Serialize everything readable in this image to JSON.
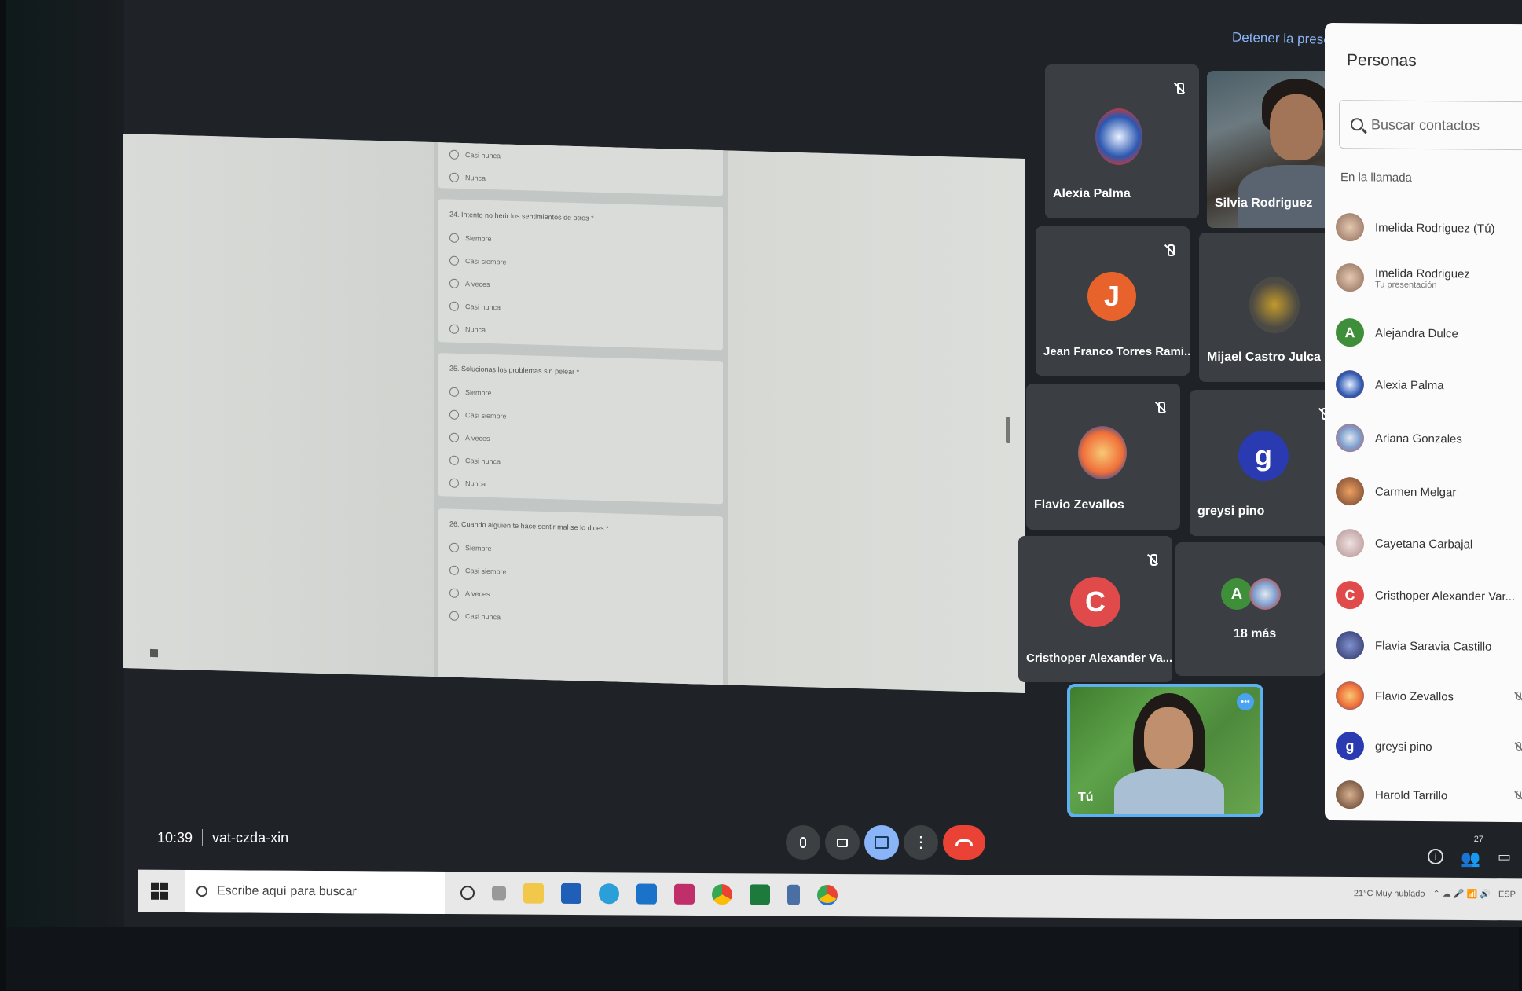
{
  "meet": {
    "stop_presenting": "Detener la presentación",
    "time": "10:39",
    "meeting_code": "vat-czda-xin"
  },
  "form": {
    "prev_options": [
      "Casi nunca",
      "Nunca"
    ],
    "questions": [
      {
        "title": "24. Intento no herir los sentimientos de otros *",
        "options": [
          "Siempre",
          "Casi siempre",
          "A veces",
          "Casi nunca",
          "Nunca"
        ]
      },
      {
        "title": "25. Solucionas los problemas sin pelear *",
        "options": [
          "Siempre",
          "Casi siempre",
          "A veces",
          "Casi nunca",
          "Nunca"
        ]
      },
      {
        "title": "26. Cuando alguien te hace sentir mal se lo dices *",
        "options": [
          "Siempre",
          "Casi siempre",
          "A veces",
          "Casi nunca"
        ]
      }
    ]
  },
  "tiles": [
    {
      "name": "Alexia Palma"
    },
    {
      "name": "Silvia Rodriguez"
    },
    {
      "name": "Jean Franco Torres Rami...",
      "initial": "J"
    },
    {
      "name": "Mijael Castro Julca"
    },
    {
      "name": "Flavio Zevallos"
    },
    {
      "name": "greysi pino",
      "initial": "g"
    },
    {
      "name": "Cristhoper Alexander Va...",
      "initial": "C"
    },
    {
      "name": "18 más",
      "initial": "A"
    },
    {
      "name": "Tú"
    }
  ],
  "people_panel": {
    "title": "Personas",
    "search_placeholder": "Buscar contactos",
    "section": "En la llamada",
    "count": "27",
    "list": [
      {
        "name": "Imelida Rodriguez (Tú)"
      },
      {
        "name": "Imelida Rodriguez",
        "sub": "Tu presentación"
      },
      {
        "name": "Alejandra Dulce",
        "initial": "A"
      },
      {
        "name": "Alexia Palma"
      },
      {
        "name": "Ariana Gonzales"
      },
      {
        "name": "Carmen Melgar"
      },
      {
        "name": "Cayetana Carbajal"
      },
      {
        "name": "Cristhoper Alexander Var...",
        "initial": "C"
      },
      {
        "name": "Flavia Saravia Castillo"
      },
      {
        "name": "Flavio Zevallos"
      },
      {
        "name": "greysi pino",
        "initial": "g"
      },
      {
        "name": "Harold Tarrillo"
      }
    ]
  },
  "taskbar": {
    "search_placeholder": "Escribe aquí para buscar",
    "weather": "21°C Muy nublado",
    "lang": "ESP"
  },
  "colors": {
    "accent": "#8ab4f8",
    "end_call": "#ea4335",
    "avatar_orange": "#e8632b",
    "avatar_blue": "#2a3ab0",
    "avatar_red": "#e04a4a",
    "avatar_green": "#3f8f3a"
  }
}
